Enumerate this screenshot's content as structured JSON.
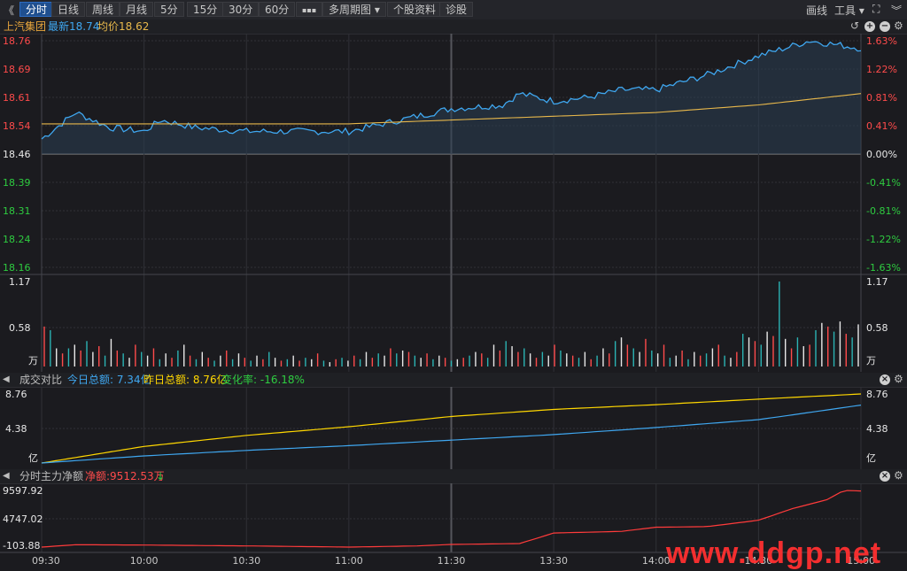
{
  "toolbar": {
    "back": "《",
    "tabs": [
      "分时",
      "日线",
      "周线",
      "月线",
      "5分",
      "15分",
      "30分",
      "60分",
      "▪▪▪",
      "多周期图 ▾",
      "个股资料",
      "诊股"
    ],
    "right_draw": "画线",
    "right_tools": "工具 ▾"
  },
  "price_header": {
    "name": "上汽集团",
    "latest_label": "最新",
    "latest": "18.74",
    "avg_label": "均价",
    "avg": "18.62"
  },
  "price_axis_left": [
    "18.76",
    "18.69",
    "18.61",
    "18.54",
    "18.46",
    "18.39",
    "18.31",
    "18.24",
    "18.16"
  ],
  "price_axis_right": [
    "1.63%",
    "1.22%",
    "0.81%",
    "0.41%",
    "0.00%",
    "-0.41%",
    "-0.81%",
    "-1.22%",
    "-1.63%"
  ],
  "volume_axis": {
    "top": "1.17",
    "mid": "0.58",
    "unit": "万"
  },
  "turnover_header": {
    "title": "成交对比",
    "today": "今日总额: 7.34亿",
    "yesterday": "昨日总额: 8.76亿",
    "change": "变化率: -16.18%"
  },
  "turnover_axis": {
    "top": "8.76",
    "mid": "4.38",
    "unit": "亿"
  },
  "flow_header": {
    "title": "分时主力净额",
    "net": "净额:9512.53万",
    "arrow": "↓"
  },
  "flow_axis": [
    "9597.92",
    "4747.02",
    "-103.88"
  ],
  "time_axis": [
    "09:30",
    "10:00",
    "10:30",
    "11:00",
    "11:30",
    "13:30",
    "14:00",
    "14:30",
    "15:00"
  ],
  "watermark": "www.ddgp.net",
  "colors": {
    "up": "#ff4b4b",
    "down": "#2ecc40",
    "price_line": "#3fa7f0",
    "avg_line": "#e8b84b",
    "flow_line": "#ff3b3b",
    "volume_white": "#e8e8e8",
    "volume_teal": "#2bb3b3"
  },
  "chart_data": [
    {
      "type": "line",
      "title": "上汽集团",
      "ylim": [
        18.16,
        18.76
      ],
      "series": [
        {
          "name": "最新",
          "x": [
            0,
            10,
            20,
            30,
            35,
            45,
            60,
            75,
            90,
            105,
            120,
            135,
            140,
            150,
            160,
            170,
            180,
            195,
            210,
            225,
            240
          ],
          "values": [
            18.5,
            18.57,
            18.53,
            18.52,
            18.55,
            18.53,
            18.52,
            18.52,
            18.52,
            18.55,
            18.58,
            18.59,
            18.62,
            18.6,
            18.61,
            18.63,
            18.63,
            18.67,
            18.72,
            18.76,
            18.74
          ]
        },
        {
          "name": "均价",
          "x": [
            0,
            30,
            60,
            90,
            120,
            150,
            180,
            210,
            240
          ],
          "values": [
            18.54,
            18.54,
            18.54,
            18.54,
            18.55,
            18.56,
            18.57,
            18.59,
            18.62
          ]
        }
      ]
    },
    {
      "type": "bar",
      "ylim": [
        0,
        1.17
      ],
      "values": [
        0.55,
        0.5,
        0.25,
        0.18,
        0.25,
        0.3,
        0.22,
        0.35,
        0.2,
        0.28,
        0.15,
        0.38,
        0.22,
        0.18,
        0.12,
        0.3,
        0.2,
        0.15,
        0.25,
        0.1,
        0.18,
        0.12,
        0.22,
        0.3,
        0.15,
        0.1,
        0.2,
        0.12,
        0.08,
        0.15,
        0.22,
        0.1,
        0.18,
        0.12,
        0.08,
        0.15,
        0.1,
        0.2,
        0.12,
        0.08,
        0.1,
        0.15,
        0.08,
        0.12,
        0.1,
        0.18,
        0.08,
        0.06,
        0.1,
        0.12,
        0.08,
        0.15,
        0.1,
        0.2,
        0.12,
        0.18,
        0.15,
        0.25,
        0.18,
        0.22,
        0.2,
        0.15,
        0.12,
        0.18,
        0.1,
        0.15,
        0.12,
        0.08,
        0.1,
        0.12,
        0.15,
        0.2,
        0.18,
        0.12,
        0.3,
        0.22,
        0.35,
        0.28,
        0.2,
        0.25,
        0.18,
        0.12,
        0.2,
        0.15,
        0.3,
        0.22,
        0.18,
        0.15,
        0.12,
        0.2,
        0.1,
        0.15,
        0.25,
        0.18,
        0.35,
        0.4,
        0.3,
        0.25,
        0.2,
        0.38,
        0.22,
        0.18,
        0.3,
        0.12,
        0.15,
        0.22,
        0.1,
        0.2,
        0.15,
        0.18,
        0.25,
        0.3,
        0.15,
        0.12,
        0.2,
        0.45,
        0.4,
        0.35,
        0.3,
        0.48,
        0.42,
        1.17,
        0.38,
        0.25,
        0.4,
        0.28,
        0.3,
        0.5,
        0.6,
        0.55,
        0.48,
        0.62,
        0.45,
        0.4,
        0.58
      ]
    },
    {
      "type": "line",
      "title": "成交对比",
      "ylim": [
        0,
        8.76
      ],
      "series": [
        {
          "name": "今日总额",
          "x": [
            0,
            30,
            60,
            90,
            120,
            150,
            180,
            210,
            240
          ],
          "values": [
            0,
            0.9,
            1.6,
            2.2,
            2.9,
            3.6,
            4.5,
            5.5,
            7.34
          ]
        },
        {
          "name": "昨日总额",
          "x": [
            0,
            30,
            60,
            90,
            120,
            150,
            180,
            210,
            240
          ],
          "values": [
            0,
            2.1,
            3.5,
            4.6,
            5.9,
            6.8,
            7.4,
            8.1,
            8.76
          ]
        }
      ]
    },
    {
      "type": "line",
      "title": "分时主力净额",
      "ylim": [
        -103.88,
        9597.92
      ],
      "series": [
        {
          "name": "净额",
          "x": [
            0,
            10,
            30,
            60,
            90,
            110,
            120,
            140,
            150,
            170,
            180,
            195,
            210,
            220,
            230,
            235,
            240
          ],
          "values": [
            -103,
            300,
            250,
            100,
            -103,
            100,
            350,
            500,
            2300,
            2600,
            3300,
            3400,
            4500,
            6500,
            8000,
            9597,
            9512
          ]
        }
      ]
    }
  ]
}
